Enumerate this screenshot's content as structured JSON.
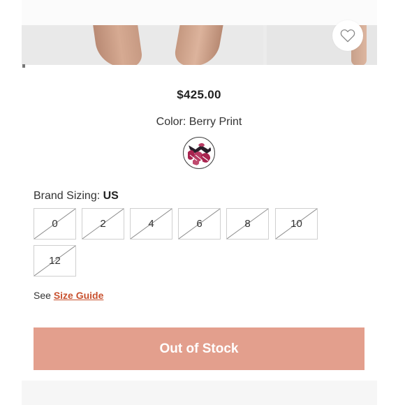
{
  "product": {
    "price": "$425.00",
    "color_label": "Color:",
    "color_value": "Berry Print"
  },
  "sizing": {
    "label": "Brand Sizing:",
    "unit": "US",
    "sizes": [
      "0",
      "2",
      "4",
      "6",
      "8",
      "10",
      "12"
    ],
    "guide_prefix": "See",
    "guide_link": "Size Guide"
  },
  "cta": {
    "label": "Out of Stock"
  },
  "colors": {
    "button_bg": "#e39f8d",
    "link": "#c8502e",
    "swatch_print": "#a8234f"
  },
  "icons": {
    "wishlist": "heart-outline-icon"
  }
}
